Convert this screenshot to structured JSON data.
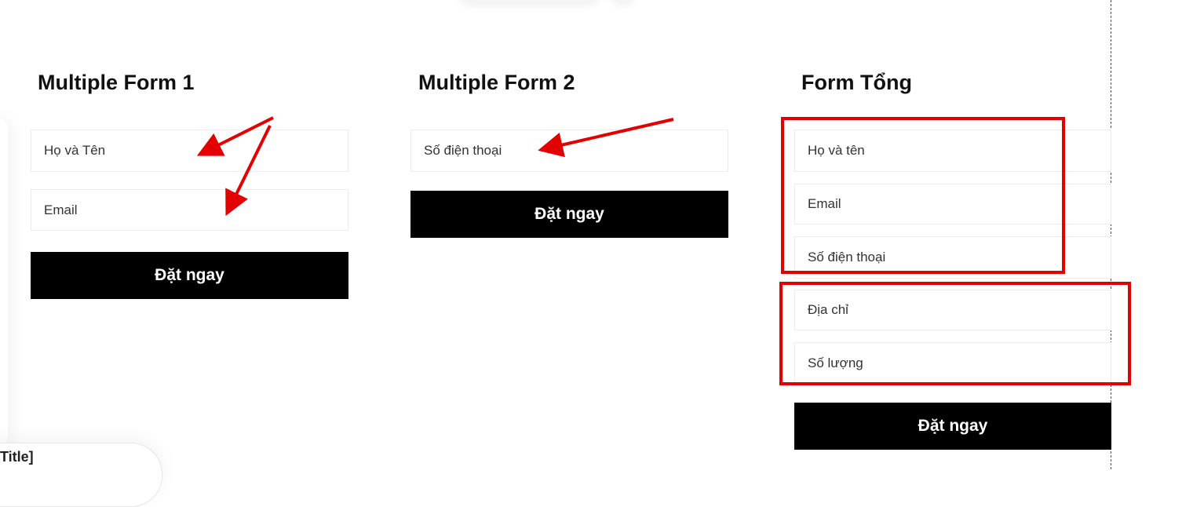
{
  "forms": [
    {
      "title": "Multiple Form 1",
      "fields": [
        "Họ và Tên",
        "Email"
      ],
      "button": "Đặt ngay"
    },
    {
      "title": "Multiple Form 2",
      "fields": [
        "Số điện thoại"
      ],
      "button": "Đặt ngay"
    },
    {
      "title": "Form Tổng",
      "fields": [
        "Họ và tên",
        "Email",
        "Số điện thoại",
        "Địa chỉ",
        "Số lượng"
      ],
      "button": "Đặt ngay"
    }
  ],
  "bottom_card": {
    "title": "Title]"
  },
  "colors": {
    "button_bg": "#000000",
    "button_text": "#ffffff",
    "annotation": "#e30000",
    "guide_line": "#3a3ad6"
  }
}
